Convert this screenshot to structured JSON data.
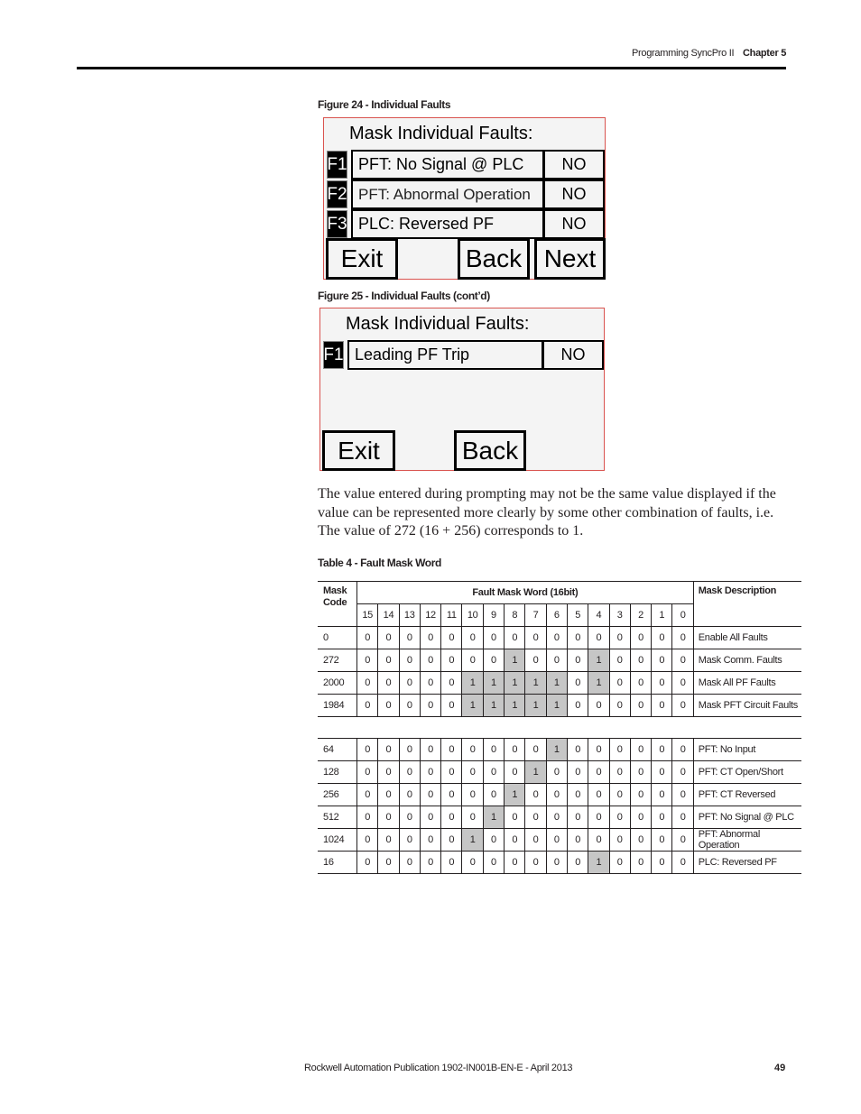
{
  "header": {
    "section": "Programming SyncPro II",
    "chapter": "Chapter 5"
  },
  "figure24": {
    "caption": "Figure 24 - Individual Faults",
    "title": "Mask Individual Faults:",
    "rows": [
      {
        "key": "F1",
        "label": "PFT: No Signal @ PLC",
        "value": "NO"
      },
      {
        "key": "F2",
        "label": "PFT: Abnormal Operation",
        "value": "NO"
      },
      {
        "key": "F3",
        "label": "PLC: Reversed PF",
        "value": "NO"
      }
    ],
    "buttons": {
      "exit": "Exit",
      "back": "Back",
      "next": "Next"
    }
  },
  "figure25": {
    "caption": "Figure 25 - Individual Faults (cont’d)",
    "title": "Mask Individual Faults:",
    "rows": [
      {
        "key": "F1",
        "label": "Leading PF Trip",
        "value": "NO"
      }
    ],
    "buttons": {
      "exit": "Exit",
      "back": "Back"
    }
  },
  "paragraph": "The value entered during prompting may not be the same value displayed if the value can be represented more clearly by some other combination of faults, i.e. The value of 272 (16 + 256) corresponds to 1.",
  "table": {
    "caption": "Table 4 - Fault Mask Word",
    "headers": {
      "code": "Mask Code",
      "word": "Fault Mask Word (16bit)",
      "desc": "Mask Description",
      "bits": [
        "15",
        "14",
        "13",
        "12",
        "11",
        "10",
        "9",
        "8",
        "7",
        "6",
        "5",
        "4",
        "3",
        "2",
        "1",
        "0"
      ]
    },
    "highlight_color": "#c6c6c6",
    "group1": [
      {
        "code": "0",
        "bits": [
          0,
          0,
          0,
          0,
          0,
          0,
          0,
          0,
          0,
          0,
          0,
          0,
          0,
          0,
          0,
          0
        ],
        "desc": "Enable All Faults"
      },
      {
        "code": "272",
        "bits": [
          0,
          0,
          0,
          0,
          0,
          0,
          0,
          1,
          0,
          0,
          0,
          1,
          0,
          0,
          0,
          0
        ],
        "desc": "Mask Comm. Faults"
      },
      {
        "code": "2000",
        "bits": [
          0,
          0,
          0,
          0,
          0,
          1,
          1,
          1,
          1,
          1,
          0,
          1,
          0,
          0,
          0,
          0
        ],
        "desc": "Mask All PF Faults"
      },
      {
        "code": "1984",
        "bits": [
          0,
          0,
          0,
          0,
          0,
          1,
          1,
          1,
          1,
          1,
          0,
          0,
          0,
          0,
          0,
          0
        ],
        "desc": "Mask PFT Circuit Faults"
      }
    ],
    "group2": [
      {
        "code": "64",
        "bits": [
          0,
          0,
          0,
          0,
          0,
          0,
          0,
          0,
          0,
          1,
          0,
          0,
          0,
          0,
          0,
          0
        ],
        "desc": "PFT: No Input"
      },
      {
        "code": "128",
        "bits": [
          0,
          0,
          0,
          0,
          0,
          0,
          0,
          0,
          1,
          0,
          0,
          0,
          0,
          0,
          0,
          0
        ],
        "desc": "PFT: CT Open/Short"
      },
      {
        "code": "256",
        "bits": [
          0,
          0,
          0,
          0,
          0,
          0,
          0,
          1,
          0,
          0,
          0,
          0,
          0,
          0,
          0,
          0
        ],
        "desc": "PFT: CT Reversed"
      },
      {
        "code": "512",
        "bits": [
          0,
          0,
          0,
          0,
          0,
          0,
          1,
          0,
          0,
          0,
          0,
          0,
          0,
          0,
          0,
          0
        ],
        "desc": "PFT: No Signal @ PLC"
      },
      {
        "code": "1024",
        "bits": [
          0,
          0,
          0,
          0,
          0,
          1,
          0,
          0,
          0,
          0,
          0,
          0,
          0,
          0,
          0,
          0
        ],
        "desc": "PFT: Abnormal Operation"
      },
      {
        "code": "16",
        "bits": [
          0,
          0,
          0,
          0,
          0,
          0,
          0,
          0,
          0,
          0,
          0,
          1,
          0,
          0,
          0,
          0
        ],
        "desc": "PLC: Reversed PF"
      }
    ]
  },
  "footer": {
    "publication": "Rockwell Automation Publication 1902-IN001B-EN-E - April 2013",
    "page": "49"
  }
}
